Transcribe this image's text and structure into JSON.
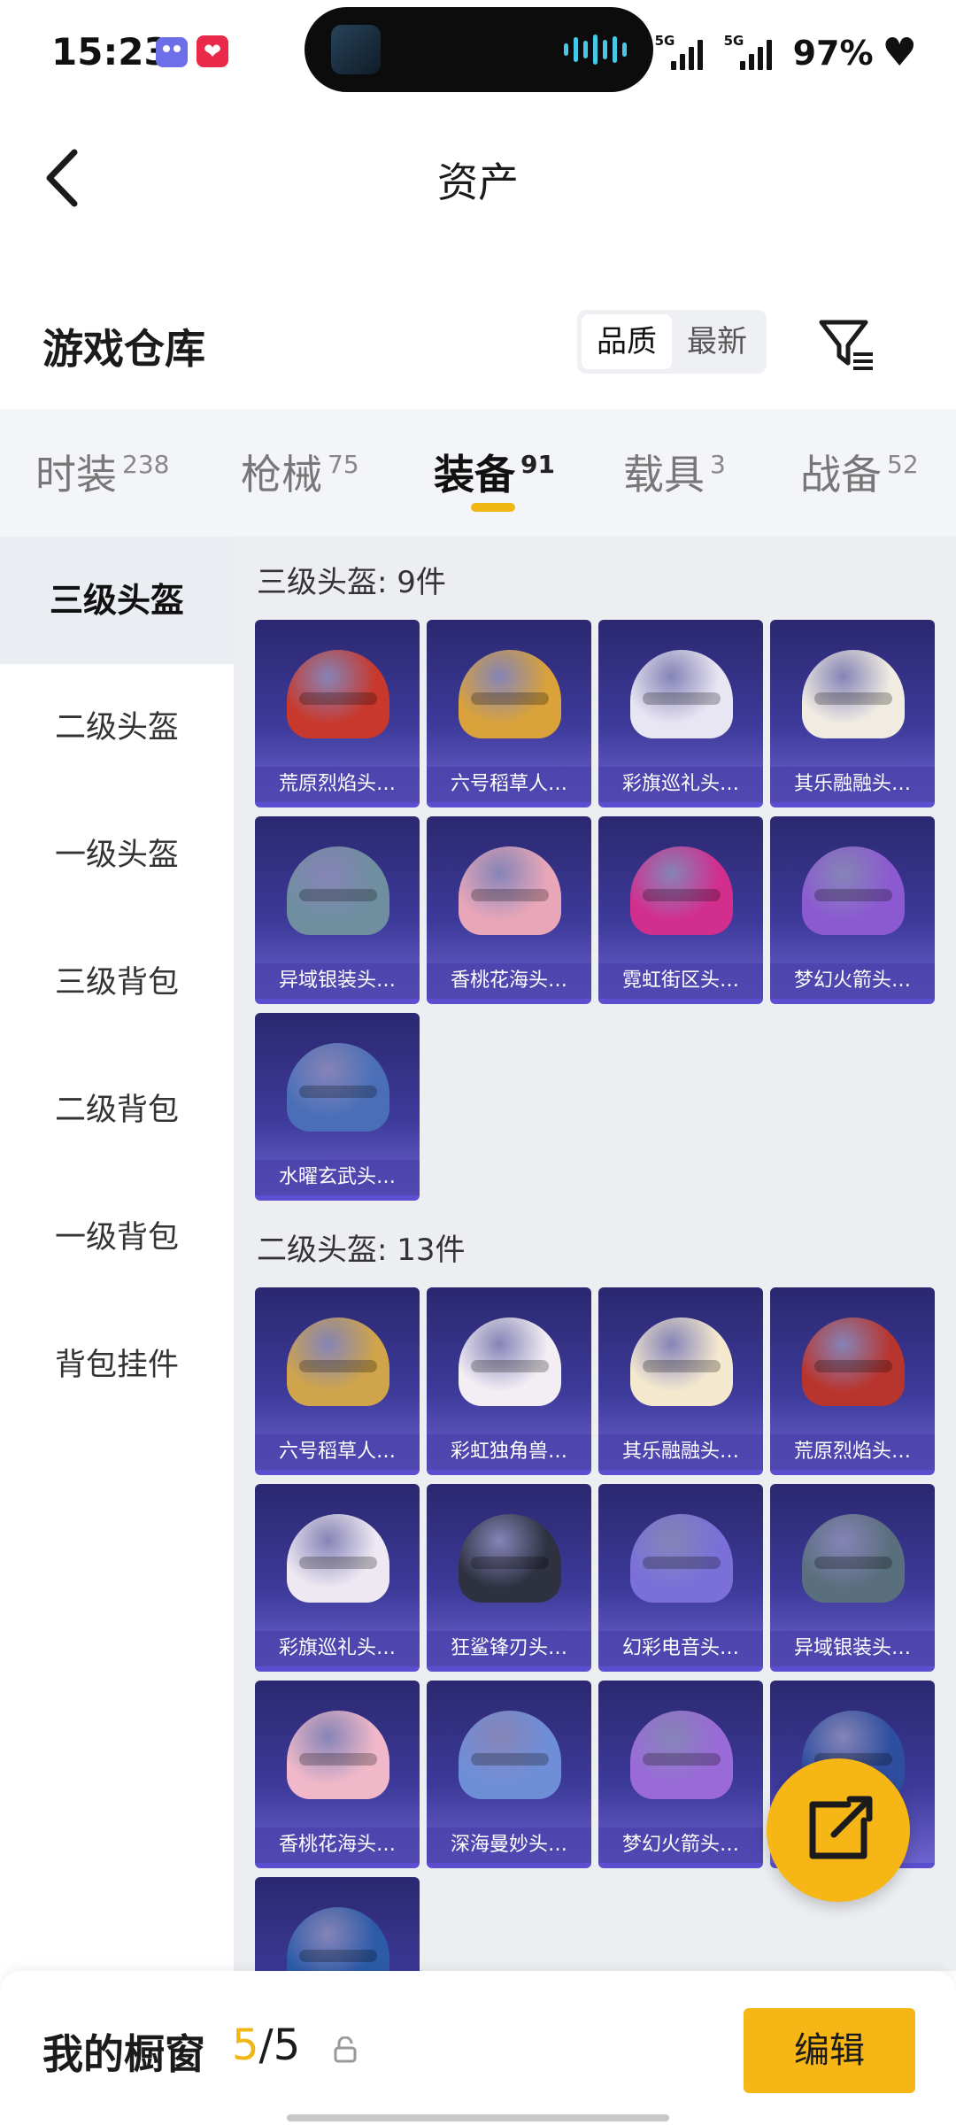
{
  "status_bar": {
    "time": "15:23",
    "net1": "5G",
    "net2": "5G",
    "battery": "97%"
  },
  "nav": {
    "title": "资产",
    "back_label": "<"
  },
  "warehouse": {
    "title": "游戏仓库",
    "sort_options": [
      "品质",
      "最新"
    ],
    "active_sort": "品质"
  },
  "tabs": [
    {
      "label": "时装",
      "count": "238"
    },
    {
      "label": "枪械",
      "count": "75"
    },
    {
      "label": "装备",
      "count": "91",
      "active": true
    },
    {
      "label": "载具",
      "count": "3"
    },
    {
      "label": "战备",
      "count": "52"
    }
  ],
  "sidebar": {
    "items": [
      "三级头盔",
      "二级头盔",
      "一级头盔",
      "三级背包",
      "二级背包",
      "一级背包",
      "背包挂件"
    ],
    "active": "三级头盔"
  },
  "sections": [
    {
      "title": "三级头盔: 9件",
      "items": [
        "荒原烈焰头…",
        "六号稻草人…",
        "彩旗巡礼头…",
        "其乐融融头…",
        "异域银装头…",
        "香桃花海头…",
        "霓虹街区头…",
        "梦幻火箭头…",
        "水曜玄武头…"
      ]
    },
    {
      "title": "二级头盔: 13件",
      "items": [
        "六号稻草人…",
        "彩虹独角兽…",
        "其乐融融头…",
        "荒原烈焰头…",
        "彩旗巡礼头…",
        "狂鲨锋刃头…",
        "幻彩电音头…",
        "异域银装头…",
        "香桃花海头…",
        "深海曼妙头…",
        "梦幻火箭头…",
        "",
        ""
      ]
    }
  ],
  "helmet_colors": {
    "s0": [
      "#c8382c",
      "#d9a23a",
      "#e9e6f3",
      "#f1ece2",
      "#6f8ea0",
      "#e8a6b8",
      "#d22e8e",
      "#8b5ad0",
      "#4a6fb8"
    ],
    "s1": [
      "#cfa44a",
      "#f3eef3",
      "#f4e9cf",
      "#b8352e",
      "#eee8f2",
      "#2d3140",
      "#7a70d8",
      "#5a6f7e",
      "#f0b8c8",
      "#6f8ed8",
      "#9a6ad8",
      "#2e4fa0",
      "#2c5ba8"
    ]
  },
  "bottom": {
    "title": "我的橱窗",
    "current": "5",
    "total": "/5",
    "edit_label": "编辑"
  }
}
